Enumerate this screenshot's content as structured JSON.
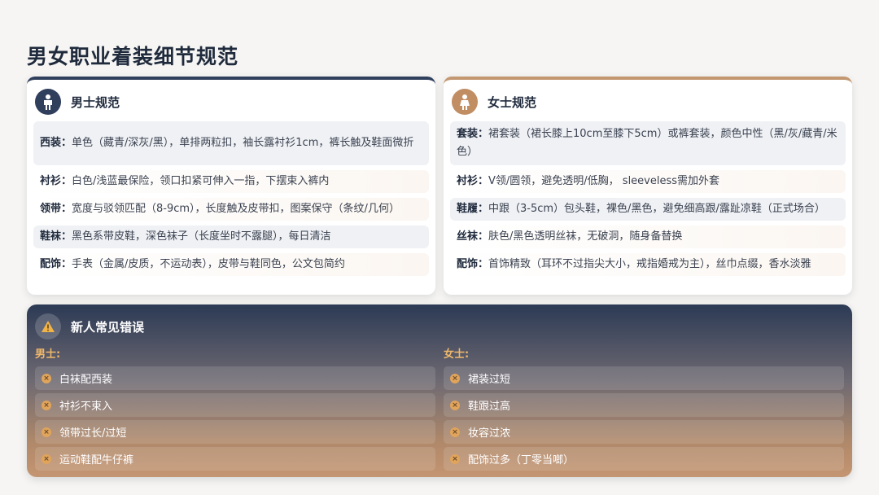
{
  "page": {
    "title": "男女职业着装细节规范"
  },
  "men": {
    "title": "男士规范",
    "rows": [
      {
        "label": "西装：",
        "text": "单色（藏青/深灰/黑），单排两粒扣，袖长露衬衫1cm，裤长触及鞋面微折"
      },
      {
        "label": "衬衫：",
        "text": "白色/浅蓝最保险，领口扣紧可伸入一指，下摆束入裤内"
      },
      {
        "label": "领带：",
        "text": "宽度与驳领匹配（8-9cm），长度触及皮带扣，图案保守（条纹/几何）"
      },
      {
        "label": "鞋袜：",
        "text": "黑色系带皮鞋，深色袜子（长度坐时不露腿），每日清洁"
      },
      {
        "label": "配饰：",
        "text": "手表（金属/皮质，不运动表），皮带与鞋同色，公文包简约"
      }
    ]
  },
  "women": {
    "title": "女士规范",
    "rows": [
      {
        "label": "套装：",
        "text": "裙套装（裙长膝上10cm至膝下5cm）或裤套装，颜色中性（黑/灰/藏青/米色）"
      },
      {
        "label": "衬衫：",
        "text": "V领/圆领，避免透明/低胸， sleeveless需加外套"
      },
      {
        "label": "鞋履：",
        "text": "中跟（3-5cm）包头鞋，裸色/黑色，避免细高跟/露趾凉鞋（正式场合）"
      },
      {
        "label": "丝袜：",
        "text": "肤色/黑色透明丝袜，无破洞，随身备替换"
      },
      {
        "label": "配饰：",
        "text": "首饰精致（耳环不过指尖大小，戒指婚戒为主），丝巾点缀，香水淡雅"
      }
    ]
  },
  "mistakes": {
    "title": "新人常见错误",
    "men_label": "男士:",
    "women_label": "女士:",
    "men_items": [
      "白袜配西装",
      "衬衫不束入",
      "领带过长/过短",
      "运动鞋配牛仔裤"
    ],
    "women_items": [
      "裙装过短",
      "鞋跟过高",
      "妆容过浓",
      "配饰过多（丁零当啷）"
    ]
  },
  "colors": {
    "navy": "#2f3f5c",
    "tan": "#c39770",
    "warning": "#e0a45b"
  },
  "icons": {
    "men": "person-icon",
    "women": "person-icon",
    "mistakes": "warning-icon",
    "item": "close-circle-icon"
  }
}
